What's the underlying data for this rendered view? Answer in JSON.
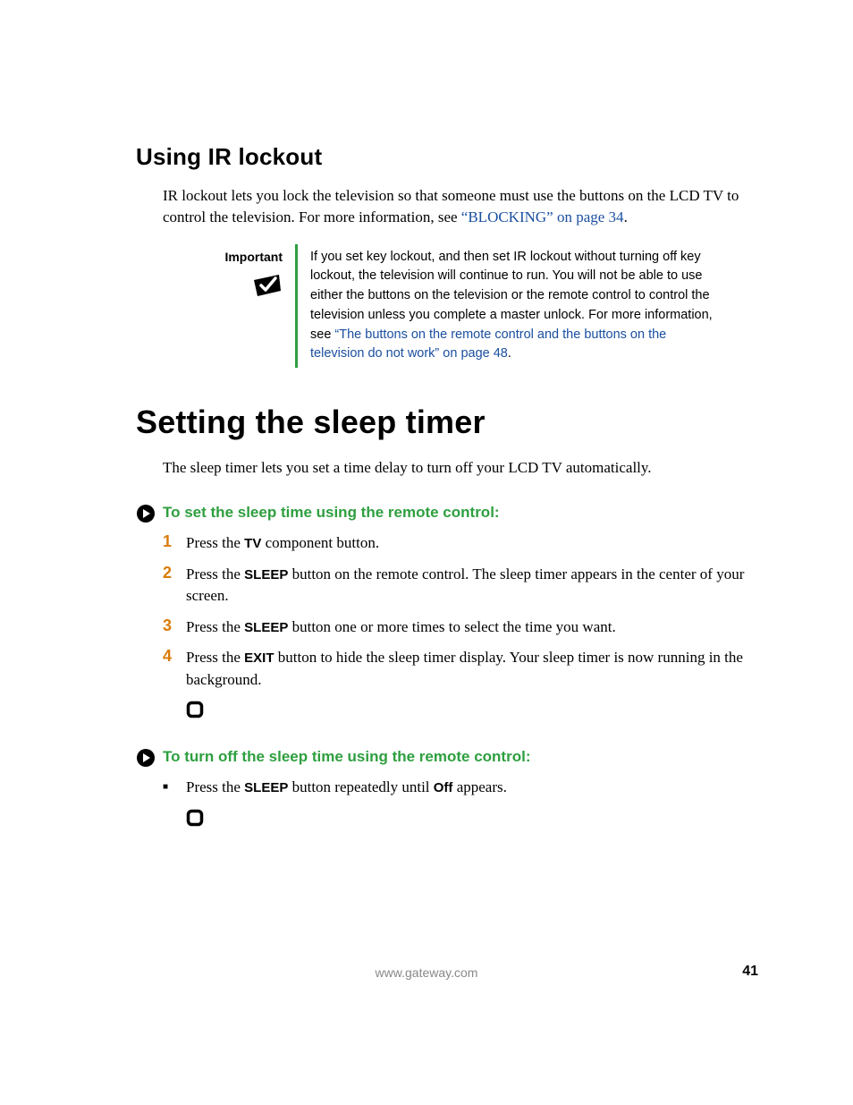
{
  "section1": {
    "heading": "Using IR lockout",
    "para_a": "IR lockout lets you lock the television so that someone must use the buttons on the LCD TV to control the television. For more information, see ",
    "para_link": "“BLOCKING” on page 34",
    "para_b": "."
  },
  "callout": {
    "label": "Important",
    "body_a": "If you set key lockout, and then set IR lockout without turning off key lockout, the television will continue to run. You will not be able to use either the buttons on the television or the remote control to control the television unless you complete a master unlock. For more information, see ",
    "body_link": "“The buttons on the remote control and the buttons on the television do not work” on page 48",
    "body_b": "."
  },
  "section2": {
    "heading": "Setting the sleep timer",
    "para": "The sleep timer lets you set a time delay to turn off your LCD TV automatically."
  },
  "proc1": {
    "heading": "To set the sleep time using the remote control:",
    "steps": [
      {
        "num": "1",
        "a": "Press the ",
        "b1": "TV",
        "c": " component button."
      },
      {
        "num": "2",
        "a": "Press the ",
        "b1": "SLEEP",
        "c": " button on the remote control. The sleep timer appears in the center of your screen."
      },
      {
        "num": "3",
        "a": "Press the ",
        "b1": "SLEEP",
        "c": " button one or more times to select the time you want."
      },
      {
        "num": "4",
        "a": "Press the ",
        "b1": "EXIT",
        "c": " button to hide the sleep timer display. Your sleep timer is now running in the background."
      }
    ]
  },
  "proc2": {
    "heading": "To turn off the sleep time using the remote control:",
    "bullet": {
      "a": "Press the ",
      "b1": "SLEEP",
      "c": " button repeatedly until ",
      "b2": "Off",
      "d": " appears."
    }
  },
  "footer": {
    "url": "www.gateway.com",
    "page": "41"
  }
}
